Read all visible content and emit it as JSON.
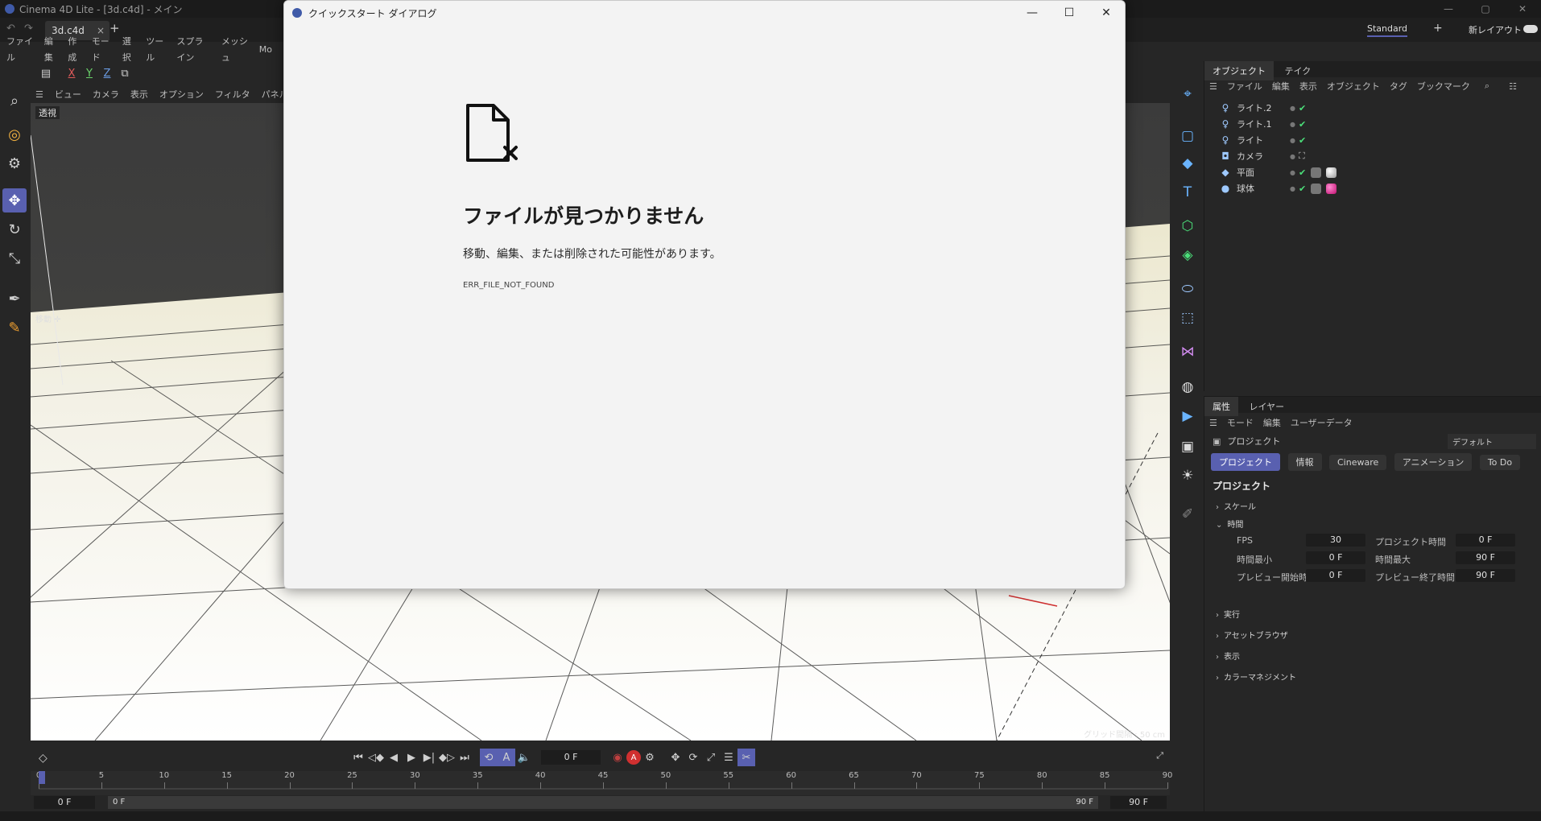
{
  "window": {
    "title": "Cinema 4D Lite - [3d.c4d] - メイン",
    "minimize": "—",
    "maximize": "▢",
    "close": "✕"
  },
  "tabs": {
    "doc": "3d.c4d",
    "close": "×",
    "add": "+",
    "layout": "Standard",
    "new_layout": "新レイアウト",
    "undo": "↶",
    "redo": "↷",
    "layout_add": "+"
  },
  "menu": [
    "ファイル",
    "編集",
    "作成",
    "モード",
    "選択",
    "ツール",
    "スプライン",
    "メッシュ",
    "Mo"
  ],
  "axes": {
    "x": "X",
    "y": "Y",
    "z": "Z"
  },
  "viewport": {
    "menu": [
      "ビュー",
      "カメラ",
      "表示",
      "オプション",
      "フィルタ",
      "パネル"
    ],
    "label": "透視",
    "move_label": "移動 ✛",
    "grid_info": "グリッド間隔 : 50 cm"
  },
  "timeline": {
    "frame_current": "0 F",
    "start": "0 F",
    "start2": "0 F",
    "end": "90 F",
    "end2": "90 F",
    "ticks": [
      "0",
      "5",
      "10",
      "15",
      "20",
      "25",
      "30",
      "35",
      "40",
      "45",
      "50",
      "55",
      "60",
      "65",
      "70",
      "75",
      "80",
      "85",
      "90"
    ]
  },
  "object_manager": {
    "tabs": [
      "オブジェクト",
      "テイク"
    ],
    "menu": [
      "ファイル",
      "編集",
      "表示",
      "オブジェクト",
      "タグ",
      "ブックマーク"
    ],
    "objects": [
      {
        "name": "ライト.2",
        "icon": "light-icon"
      },
      {
        "name": "ライト.1",
        "icon": "light-icon"
      },
      {
        "name": "ライト",
        "icon": "light-icon"
      },
      {
        "name": "カメラ",
        "icon": "camera-icon"
      },
      {
        "name": "平面",
        "icon": "plane-icon"
      },
      {
        "name": "球体",
        "icon": "sphere-icon"
      }
    ]
  },
  "attribute_manager": {
    "tabs": [
      "属性",
      "レイヤー"
    ],
    "menu": [
      "モード",
      "編集",
      "ユーザーデータ"
    ],
    "object_label": "プロジェクト",
    "preset": "デフォルト",
    "chips": [
      "プロジェクト",
      "情報",
      "Cineware",
      "アニメーション",
      "To Do"
    ],
    "heading": "プロジェクト",
    "sections": {
      "scale": "スケール",
      "time": "時間",
      "exec": "実行",
      "asset": "アセットブラウザ",
      "display": "表示",
      "color": "カラーマネジメント"
    },
    "fields": {
      "fps_label": "FPS",
      "fps": "30",
      "project_time_label": "プロジェクト時間",
      "project_time": "0 F",
      "min_label": "時間最小",
      "min": "0 F",
      "max_label": "時間最大",
      "max": "90 F",
      "preview_start_label": "プレビュー開始時間",
      "preview_start": "0 F",
      "preview_end_label": "プレビュー終了時間",
      "preview_end": "90 F"
    }
  },
  "dialog": {
    "title": "クイックスタート ダイアログ",
    "heading": "ファイルが見つかりません",
    "message": "移動、編集、または削除された可能性があります。",
    "code": "ERR_FILE_NOT_FOUND",
    "minimize": "—",
    "maximize": "☐",
    "close": "✕"
  },
  "colors": {
    "accent": "#5960b0",
    "check": "#4be07a",
    "dialog_bg": "#f3f3f3"
  }
}
